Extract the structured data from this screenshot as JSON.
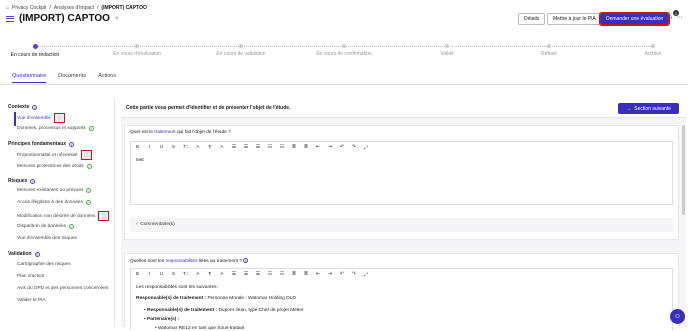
{
  "breadcrumb": {
    "items": [
      "Privacy Cockpit",
      "Analyses d'impact",
      "(IMPORT) CAPTOO"
    ],
    "sep": "/"
  },
  "header": {
    "title": "(IMPORT) CAPTOO",
    "close": "×",
    "buttons": {
      "details": "Détails",
      "update": "Mettre à jour le PIA",
      "request": "Demander une évaluation"
    },
    "notification_count": "1",
    "brand_color": "#3a2fb8",
    "highlight_color": "#c4151c"
  },
  "steps": [
    {
      "label": "En cours de rédaction",
      "active": true
    },
    {
      "label": "En cours d'évaluation",
      "active": false
    },
    {
      "label": "En cours de validation",
      "active": false
    },
    {
      "label": "En cours de confirmation",
      "active": false
    },
    {
      "label": "Validé",
      "active": false
    },
    {
      "label": "Refusé",
      "active": false
    },
    {
      "label": "Archivé",
      "active": false
    }
  ],
  "tabs": [
    "Questionnaire",
    "Documents",
    "Actions"
  ],
  "sidebar": {
    "sections": [
      {
        "title": "Contexte",
        "items": [
          "Vue d'ensemble",
          "Données, processus et supports"
        ]
      },
      {
        "title": "Principes fondamentaux",
        "items": [
          "Proportionnalité et nécessité",
          "Mesures protectrices des droits"
        ]
      },
      {
        "title": "Risques",
        "items": [
          "Mesures existantes ou prévues",
          "Accès illégitime à des données",
          "Modification non désirée de données",
          "Disparition de données",
          "Vue d'ensemble des risques"
        ]
      },
      {
        "title": "Validation",
        "items": [
          "Cartographie des risques",
          "Plan d'action",
          "Avis du DPD et des personnes concernées",
          "Valider le PIA"
        ]
      }
    ]
  },
  "main": {
    "intro": "Cette partie vous permet d'identifier et de présenter l'objet de l'étude.",
    "next_button": "Section suivante",
    "q1": {
      "before": "Quel est le ",
      "keyword": "traitement",
      "after": " qui fait l'objet de l'étude ?",
      "answer": "test"
    },
    "comments": "Commentaire(s)",
    "q2": {
      "before": "Quelles sont les ",
      "keyword": "responsabilités",
      "after": " liées au traitement ?"
    },
    "q2_text": {
      "line1": "Les responsabilités sont les suivantes:",
      "line2_bold": "Responsable(s) de traitement :",
      "line2_rest": " Personne Morale : Watomar Holding DLD",
      "bullet1_bold": "Responsable(s) de traitement :",
      "bullet1_rest": " Dupont Jean, type:Chef de projet Métier",
      "bullet2_bold": "Partenaire(s) :",
      "bullet3": "Watomar RE12 en tant que Sous-traitant"
    },
    "toolbar": [
      "B",
      "I",
      "U",
      "S",
      "T↕",
      "A",
      "¶",
      "A",
      "☰",
      "☰",
      "☰",
      "☷",
      "☷",
      "≣",
      "≣",
      "⇤",
      "⇥",
      "↶",
      "↷",
      "⤢"
    ]
  }
}
